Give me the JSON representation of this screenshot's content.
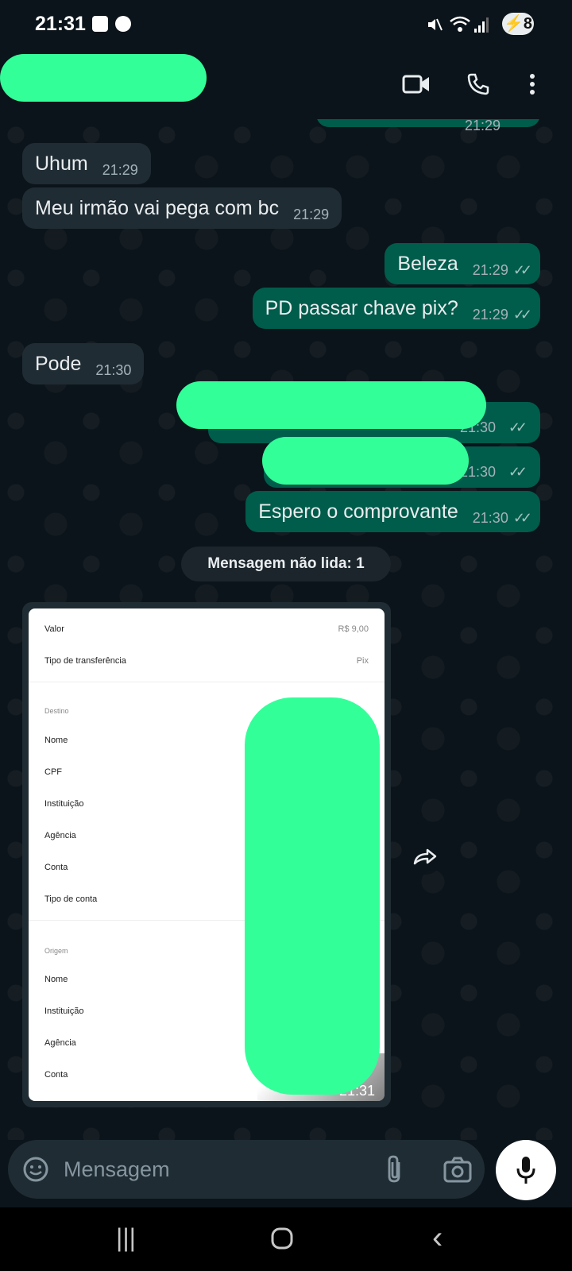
{
  "status_bar": {
    "time": "21:31",
    "battery": "8"
  },
  "header": {
    "back_icon": "arrow-left-icon",
    "video_icon": "video-call-icon",
    "call_icon": "phone-icon",
    "menu_icon": "more-vert-icon"
  },
  "messages": [
    {
      "dir": "in",
      "text": "Uhum",
      "time": "21:29"
    },
    {
      "dir": "in",
      "text": "Meu irmão vai pega com bc",
      "time": "21:29"
    },
    {
      "dir": "out",
      "text": "Beleza",
      "time": "21:29"
    },
    {
      "dir": "out",
      "text": "PD passar chave pix?",
      "time": "21:29"
    },
    {
      "dir": "in",
      "text": "Pode",
      "time": "21:30"
    },
    {
      "dir": "out",
      "text": "",
      "time": "21:30"
    },
    {
      "dir": "out",
      "text": "",
      "time": "21:30"
    },
    {
      "dir": "out",
      "text": "Espero o comprovante",
      "time": "21:30"
    }
  ],
  "partial_top_time": "21:29",
  "unread_label": "Mensagem não lida: 1",
  "receipt": {
    "valor_label": "Valor",
    "valor": "R$ 9,00",
    "tipo_label": "Tipo de transferência",
    "tipo": "Pix",
    "destino_header": "Destino",
    "destino_fields": [
      "Nome",
      "CPF",
      "Instituição",
      "Agência",
      "Conta",
      "Tipo de conta"
    ],
    "origem_header": "Origem",
    "origem_fields": [
      "Nome",
      "Instituição",
      "Agência",
      "Conta"
    ],
    "time": "21:31"
  },
  "input": {
    "placeholder": "Mensagem",
    "emoji_icon": "sticker-emoji-icon",
    "attach_icon": "paperclip-icon",
    "camera_icon": "camera-icon",
    "mic_icon": "mic-icon"
  },
  "colors": {
    "incoming": "#202c33",
    "outgoing": "#005c4b",
    "background": "#0b141a",
    "redaction": "#33ff99"
  }
}
